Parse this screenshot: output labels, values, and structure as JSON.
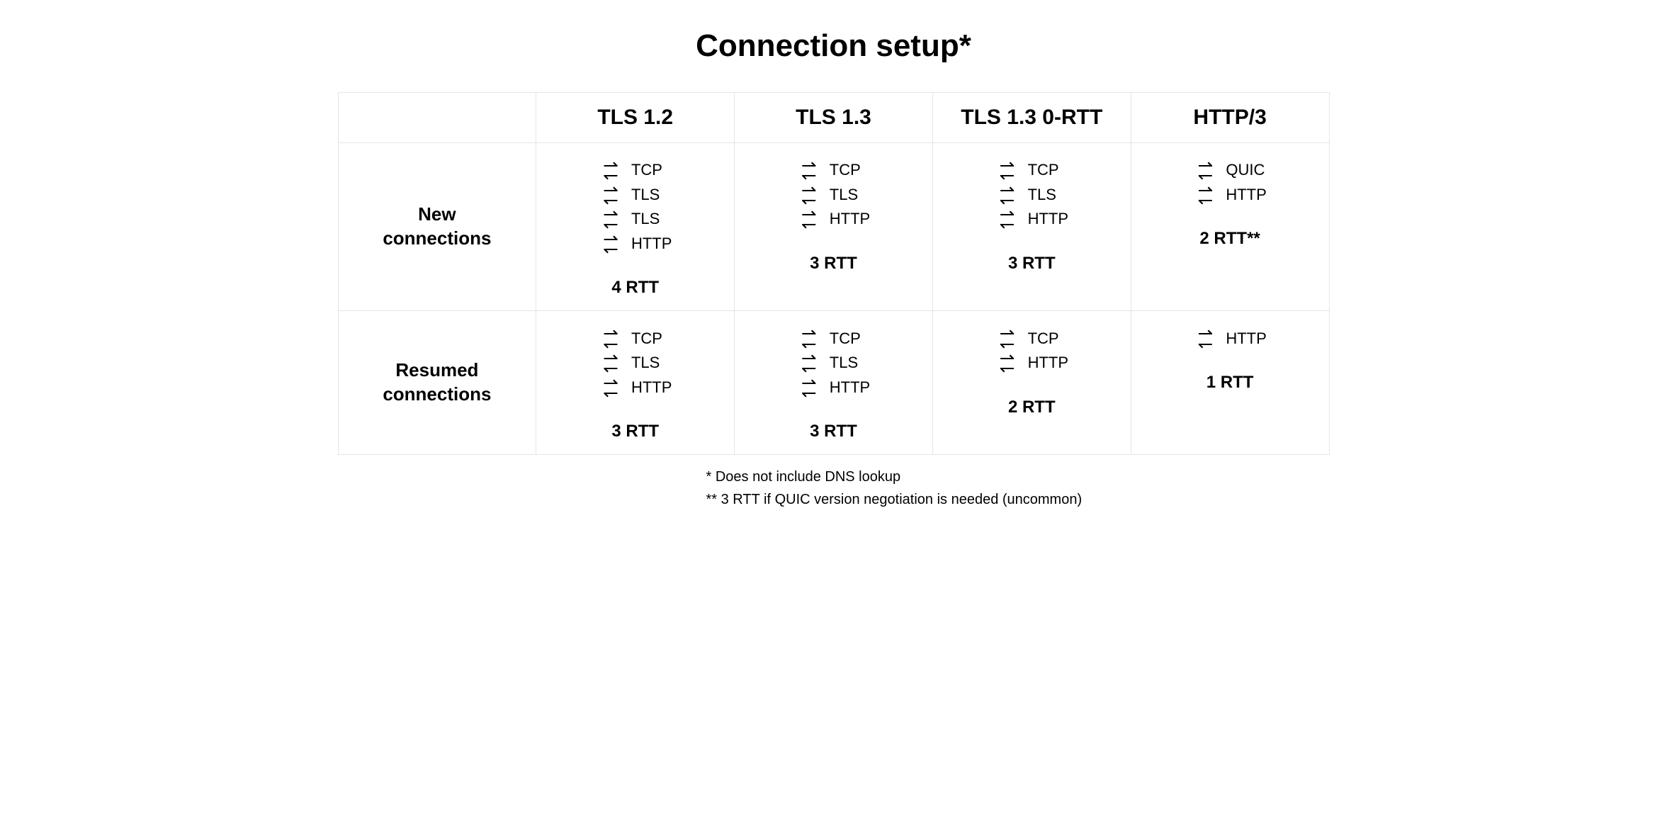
{
  "title": "Connection setup*",
  "columns": [
    "TLS 1.2",
    "TLS 1.3",
    "TLS 1.3 0-RTT",
    "HTTP/3"
  ],
  "rows": [
    {
      "head": "New\nconnections",
      "cells": [
        {
          "steps": [
            "TCP",
            "TLS",
            "TLS",
            "HTTP"
          ],
          "rtt": "4 RTT"
        },
        {
          "steps": [
            "TCP",
            "TLS",
            "HTTP"
          ],
          "rtt": "3 RTT"
        },
        {
          "steps": [
            "TCP",
            "TLS",
            "HTTP"
          ],
          "rtt": "3 RTT"
        },
        {
          "steps": [
            "QUIC",
            "HTTP"
          ],
          "rtt": "2 RTT**"
        }
      ]
    },
    {
      "head": "Resumed\nconnections",
      "cells": [
        {
          "steps": [
            "TCP",
            "TLS",
            "HTTP"
          ],
          "rtt": "3 RTT"
        },
        {
          "steps": [
            "TCP",
            "TLS",
            "HTTP"
          ],
          "rtt": "3 RTT"
        },
        {
          "steps": [
            "TCP",
            "HTTP"
          ],
          "rtt": "2 RTT"
        },
        {
          "steps": [
            "HTTP"
          ],
          "rtt": "1 RTT"
        }
      ]
    }
  ],
  "footnotes": [
    "* Does not include DNS lookup",
    "** 3 RTT if QUIC version negotiation is needed (uncommon)"
  ]
}
